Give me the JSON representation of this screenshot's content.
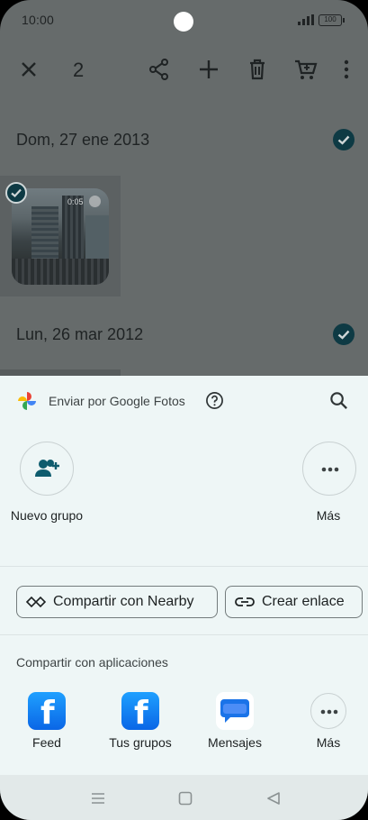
{
  "status_bar": {
    "time": "10:00",
    "battery": "100"
  },
  "top_bar": {
    "selected_count": "2"
  },
  "groups": [
    {
      "date": "Dom, 27 ene 2013",
      "video_duration": "0:05"
    },
    {
      "date": "Lun, 26 mar 2012"
    }
  ],
  "share_sheet": {
    "title": "Enviar por Google Fotos",
    "contacts": [
      {
        "label": "Nuevo grupo",
        "icon": "add-group-icon"
      },
      {
        "label": "Más",
        "icon": "more-horizontal-icon"
      }
    ],
    "actions": [
      {
        "label": "Compartir con Nearby",
        "icon": "nearby-share-icon"
      },
      {
        "label": "Crear enlace",
        "icon": "link-icon"
      }
    ],
    "apps_header": "Compartir con aplicaciones",
    "apps": [
      {
        "label": "Feed",
        "icon": "facebook-icon"
      },
      {
        "label": "Tus grupos",
        "icon": "facebook-icon"
      },
      {
        "label": "Mensajes",
        "icon": "messages-icon"
      },
      {
        "label": "Más",
        "icon": "more-horizontal-icon"
      }
    ]
  },
  "colors": {
    "sheet_bg": "#eef6f6",
    "accent": "#0e5c6e",
    "check": "#0e3a44",
    "facebook": "#0a66e6"
  }
}
